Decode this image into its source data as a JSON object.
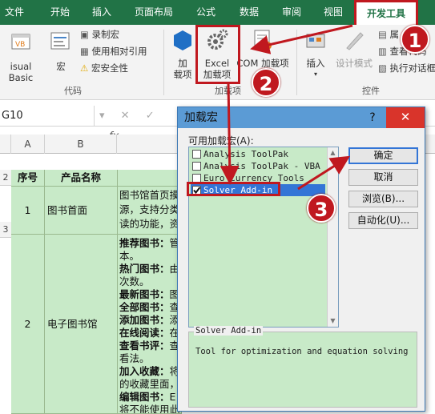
{
  "ribbon_tabs": [
    "文件",
    "开始",
    "插入",
    "页面布局",
    "公式",
    "数据",
    "审阅",
    "视图",
    "开发工具"
  ],
  "ribbon": {
    "visual_basic": "isual Basic",
    "macro": "宏",
    "record_macro": "录制宏",
    "relative_ref": "使用相对引用",
    "macro_security": "宏安全性",
    "group_code": "代码",
    "addins_label_1": "加",
    "addins_label_2": "载项",
    "excel_addins_1": "Excel",
    "excel_addins_2": "加载项",
    "com_addins": "COM 加载项",
    "group_addins": "加载项",
    "insert": "插入",
    "design_mode": "设计模式",
    "properties": "属",
    "view_code": "查看代码",
    "run_dialog": "执行对话框",
    "group_controls": "控件"
  },
  "formula_bar": {
    "namebox": "G10",
    "fx": "fx"
  },
  "columns": [
    "A",
    "B"
  ],
  "sheet": {
    "row_headers": [
      "2",
      "3"
    ],
    "header_seq": "序号",
    "header_name": "产品名称",
    "row1_seq": "1",
    "row1_name": "图书首面",
    "row1_desc_1": "图书馆首页摸",
    "row1_desc_2": "源，支持分类",
    "row1_desc_3": "读的功能，资",
    "row2_seq": "2",
    "row2_name": "电子图书馆",
    "row2_lines": [
      {
        "b": "推荐图书：",
        "t": "管"
      },
      {
        "b": "",
        "t": "本。"
      },
      {
        "b": "热门图书：",
        "t": "由"
      },
      {
        "b": "",
        "t": "次数。"
      },
      {
        "b": "最新图书：",
        "t": "图"
      },
      {
        "b": "全部图书：",
        "t": "查"
      },
      {
        "b": "添加图书：",
        "t": "添"
      },
      {
        "b": "在线阅读：",
        "t": "在"
      },
      {
        "b": "查看书评：",
        "t": "查"
      },
      {
        "b": "",
        "t": "看法。"
      },
      {
        "b": "加入收藏：",
        "t": "将"
      },
      {
        "b": "",
        "t": "的收藏里面，"
      },
      {
        "b": "编辑图书：",
        "t": "E"
      },
      {
        "b": "",
        "t": "将不能使用此"
      }
    ]
  },
  "dialog": {
    "title": "加载宏",
    "help": "?",
    "close": "✕",
    "available_label": "可用加载宏(A):",
    "addins": [
      {
        "name": "Analysis ToolPak",
        "checked": false,
        "selected": false
      },
      {
        "name": "Analysis ToolPak - VBA",
        "checked": false,
        "selected": false
      },
      {
        "name": "Euro Currency Tools",
        "checked": false,
        "selected": false
      },
      {
        "name": "Solver Add-in",
        "checked": true,
        "selected": true
      }
    ],
    "buttons": {
      "ok": "确定",
      "cancel": "取消",
      "browse": "浏览(B)...",
      "automation": "自动化(U)..."
    },
    "desc_title": "Solver Add-in",
    "desc_text": "Tool for optimization and equation solving"
  },
  "annotations": [
    "1",
    "2",
    "3"
  ],
  "colors": {
    "ribbon_green": "#217346",
    "highlight_red": "#c0181f",
    "cell_green": "#c8eac8",
    "title_blue": "#5b9bd5",
    "select_blue": "#3375d6"
  }
}
